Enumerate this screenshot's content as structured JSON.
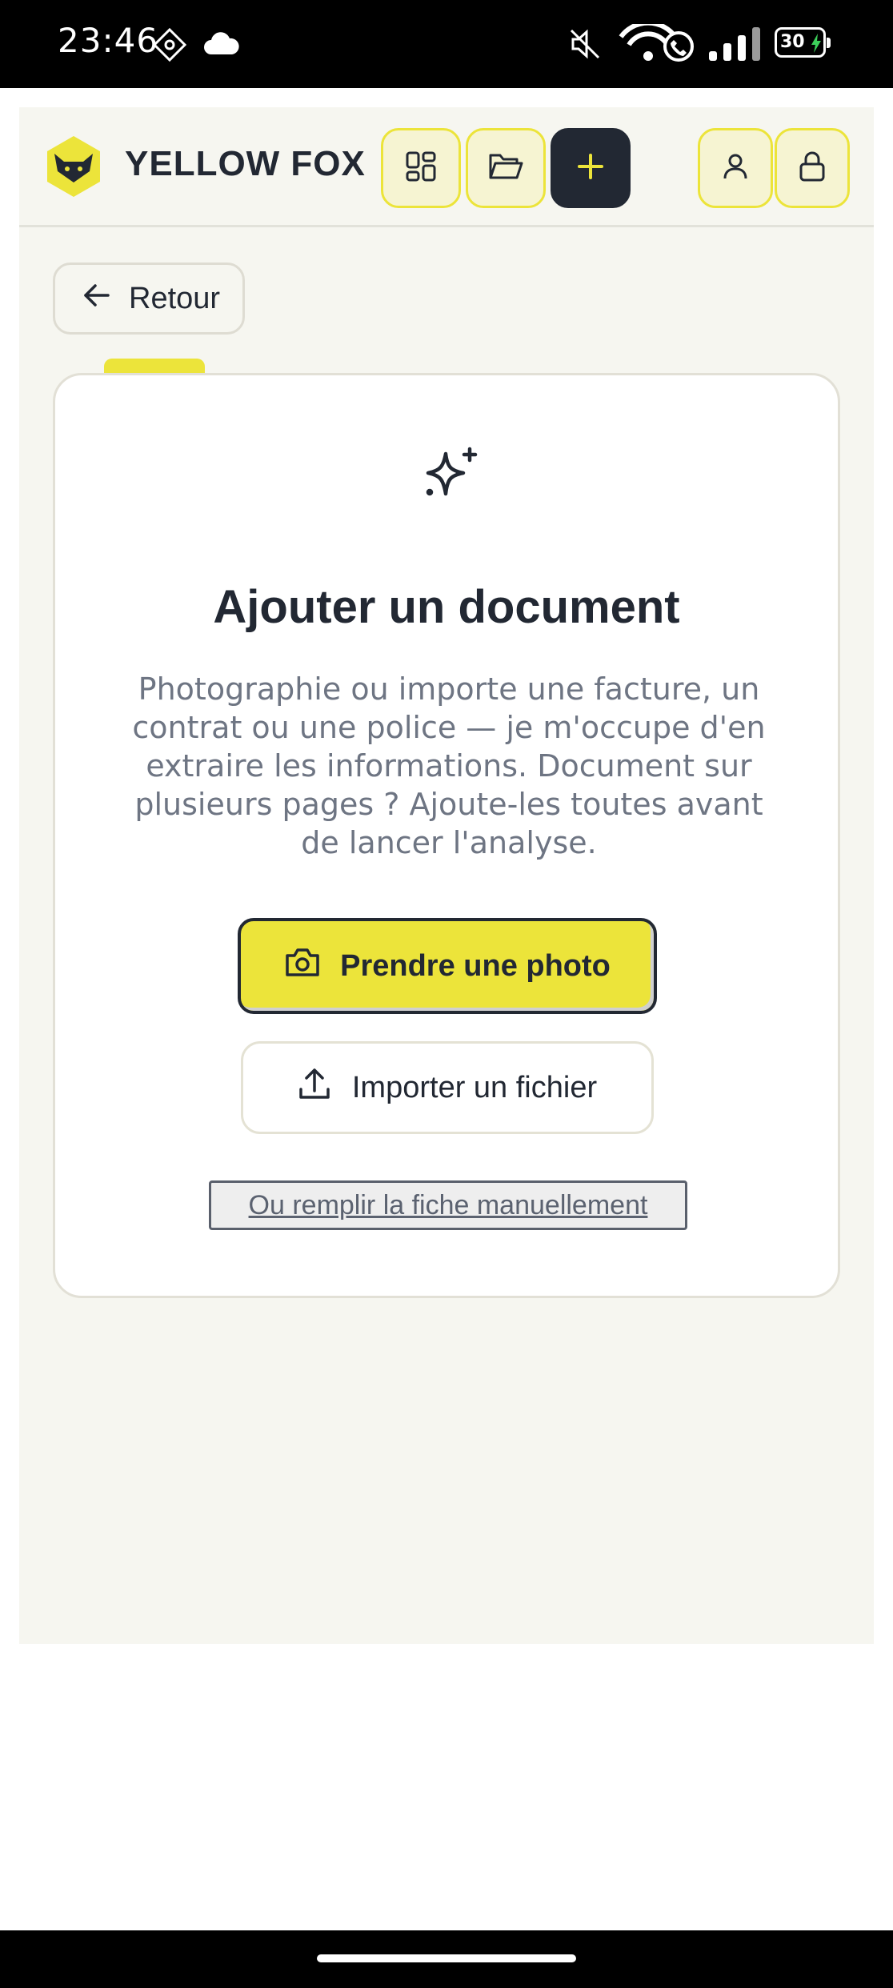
{
  "status_bar": {
    "time": "23:46",
    "battery": "30",
    "icons": [
      "diamond-location-icon",
      "cloud-icon",
      "mute-icon",
      "wifi-call-icon",
      "signal-icon",
      "battery-charging-icon"
    ]
  },
  "header": {
    "brand": "YELLOW FOX",
    "buttons": [
      "dashboard-icon",
      "folder-icon",
      "plus-icon",
      "user-icon",
      "lock-icon"
    ],
    "accent_color": "#ece43a",
    "dark_color": "#222833"
  },
  "back_button": {
    "label": "Retour"
  },
  "card": {
    "icon": "sparkle-icon",
    "title": "Ajouter un document",
    "description": "Photographie ou importe une facture, un contrat ou une police — je m'occupe d'en extraire les informations. Document sur plusieurs pages ? Ajoute-les toutes avant de lancer l'analyse.",
    "photo_button": "Prendre une photo",
    "import_button": "Importer un fichier",
    "manual_link": "Ou remplir la fiche manuellement"
  }
}
